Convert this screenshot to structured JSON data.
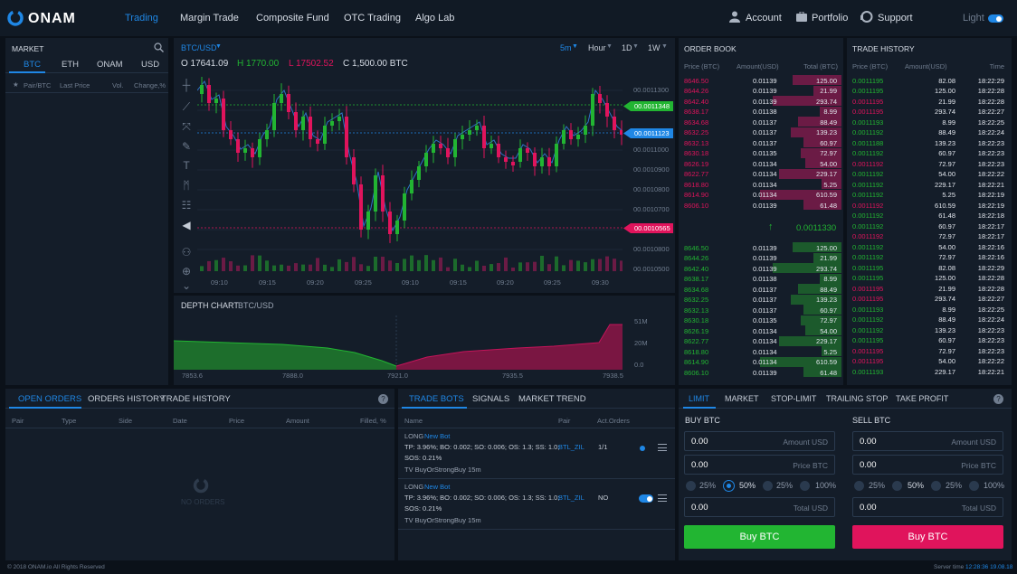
{
  "brand": {
    "name": "ONAM"
  },
  "nav": {
    "items": [
      "Trading",
      "Margin Trade",
      "Composite Fund",
      "OTC Trading",
      "Algo Lab"
    ],
    "account": "Account",
    "portfolio": "Portfolio",
    "support": "Support",
    "theme_label": "Light"
  },
  "market": {
    "title": "MARKET",
    "tabs": [
      "BTC",
      "ETH",
      "ONAM",
      "USD"
    ],
    "columns": [
      "Pair/BTC",
      "Last Price",
      "Vol.",
      "Change,%"
    ]
  },
  "chart": {
    "pair": "BTC/USD",
    "interval": "5m",
    "period_options": [
      "Hour",
      "1D",
      "1W"
    ],
    "ohlc": {
      "open": "O 17641.09",
      "high": "H 1770.00",
      "low": "L 17502.52",
      "close": "C 1,500.00 BTC"
    },
    "price_axis": [
      "00.0011300",
      "00.0011348",
      "00.0011123",
      "00.0011000",
      "00.0010900",
      "00.0010800",
      "00.0010700",
      "00.0010565",
      "00.0010800",
      "00.0010500"
    ],
    "time_axis": [
      "09:10",
      "09:15",
      "09:20",
      "09:25",
      "09:10",
      "09:15",
      "09:20",
      "09:25",
      "09:30"
    ]
  },
  "depth": {
    "title": "DEPTH CHART",
    "pair": "BTC/USD",
    "x_axis": [
      "7853.6",
      "7888.0",
      "7921.0",
      "7935.5",
      "7938.5"
    ],
    "y_axis": [
      "51M",
      "20M",
      "0.0"
    ]
  },
  "order_book": {
    "title": "ORDER BOOK",
    "columns": [
      "Price (BTC)",
      "Amount(USD)",
      "Total (BTC)"
    ],
    "asks": [
      [
        "8646.50",
        "0.01139",
        "125.00"
      ],
      [
        "8644.26",
        "0.01139",
        "21.99"
      ],
      [
        "8642.40",
        "0.01139",
        "293.74"
      ],
      [
        "8638.17",
        "0.01138",
        "8.99"
      ],
      [
        "8634.68",
        "0.01137",
        "88.49"
      ],
      [
        "8632.25",
        "0.01137",
        "139.23"
      ],
      [
        "8632.13",
        "0.01137",
        "60.97"
      ],
      [
        "8630.18",
        "0.01135",
        "72.97"
      ],
      [
        "8626.19",
        "0.01134",
        "54.00"
      ],
      [
        "8622.77",
        "0.01134",
        "229.17"
      ],
      [
        "8618.80",
        "0.01134",
        "5.25"
      ],
      [
        "8614.90",
        "0.01134",
        "610.59"
      ],
      [
        "8606.10",
        "0.01139",
        "61.48"
      ]
    ],
    "spread": "0.0011330",
    "bids": [
      [
        "8646.50",
        "0.01139",
        "125.00"
      ],
      [
        "8644.26",
        "0.01139",
        "21.99"
      ],
      [
        "8642.40",
        "0.01139",
        "293.74"
      ],
      [
        "8638.17",
        "0.01138",
        "8.99"
      ],
      [
        "8634.68",
        "0.01137",
        "88.49"
      ],
      [
        "8632.25",
        "0.01137",
        "139.23"
      ],
      [
        "8632.13",
        "0.01137",
        "60.97"
      ],
      [
        "8630.18",
        "0.01135",
        "72.97"
      ],
      [
        "8626.19",
        "0.01134",
        "54.00"
      ],
      [
        "8622.77",
        "0.01134",
        "229.17"
      ],
      [
        "8618.80",
        "0.01134",
        "5.25"
      ],
      [
        "8614.90",
        "0.01134",
        "610.59"
      ],
      [
        "8606.10",
        "0.01139",
        "61.48"
      ]
    ]
  },
  "trade_history": {
    "title": "TRADE HISTORY",
    "columns": [
      "Price (BTC)",
      "Amount(USD)",
      "Time"
    ],
    "rows": [
      [
        "0.0011195",
        "82.08",
        "18:22:29",
        "g"
      ],
      [
        "0.0011195",
        "125.00",
        "18:22:28",
        "g"
      ],
      [
        "0.0011195",
        "21.99",
        "18:22:28",
        "r"
      ],
      [
        "0.0011195",
        "293.74",
        "18:22:27",
        "r"
      ],
      [
        "0.0011193",
        "8.99",
        "18:22:25",
        "g"
      ],
      [
        "0.0011192",
        "88.49",
        "18:22:24",
        "g"
      ],
      [
        "0.0011188",
        "139.23",
        "18:22:23",
        "g"
      ],
      [
        "0.0011192",
        "60.97",
        "18:22:23",
        "g"
      ],
      [
        "0.0011192",
        "72.97",
        "18:22:23",
        "r"
      ],
      [
        "0.0011192",
        "54.00",
        "18:22:22",
        "g"
      ],
      [
        "0.0011192",
        "229.17",
        "18:22:21",
        "g"
      ],
      [
        "0.0011192",
        "5.25",
        "18:22:19",
        "g"
      ],
      [
        "0.0011192",
        "610.59",
        "18:22:19",
        "r"
      ],
      [
        "0.0011192",
        "61.48",
        "18:22:18",
        "g"
      ],
      [
        "0.0011192",
        "60.97",
        "18:22:17",
        "g"
      ],
      [
        "0.0011192",
        "72.97",
        "18:22:17",
        "r"
      ],
      [
        "0.0011192",
        "54.00",
        "18:22:16",
        "g"
      ],
      [
        "0.0011192",
        "72.97",
        "18:22:16",
        "g"
      ],
      [
        "0.0011195",
        "82.08",
        "18:22:29",
        "g"
      ],
      [
        "0.0011195",
        "125.00",
        "18:22:28",
        "g"
      ],
      [
        "0.0011195",
        "21.99",
        "18:22:28",
        "r"
      ],
      [
        "0.0011195",
        "293.74",
        "18:22:27",
        "r"
      ],
      [
        "0.0011193",
        "8.99",
        "18:22:25",
        "g"
      ],
      [
        "0.0011192",
        "88.49",
        "18:22:24",
        "g"
      ],
      [
        "0.0011192",
        "139.23",
        "18:22:23",
        "g"
      ],
      [
        "0.0011195",
        "60.97",
        "18:22:23",
        "g"
      ],
      [
        "0.0011195",
        "72.97",
        "18:22:23",
        "r"
      ],
      [
        "0.0011195",
        "54.00",
        "18:22:22",
        "r"
      ],
      [
        "0.0011193",
        "229.17",
        "18:22:21",
        "g"
      ]
    ]
  },
  "orders": {
    "tabs": [
      "OPEN ORDERS",
      "ORDERS HISTORY",
      "TRADE HISTORY"
    ],
    "columns": [
      "Pair",
      "Type",
      "Side",
      "Date",
      "Price",
      "Amount",
      "Filled, %"
    ],
    "empty": "NO ORDERS"
  },
  "bots": {
    "tabs": [
      "TRADE BOTS",
      "SIGNALS",
      "MARKET TREND"
    ],
    "columns": [
      "Name",
      "Pair",
      "Act.Orders"
    ],
    "items": [
      {
        "side": "LONG",
        "tag": "New Bot",
        "params": "TP: 3.96%; BO: 0.002; SO: 0.006; OS: 1.3; SS: 1.0;",
        "params2": "SOS: 0.21%",
        "pair": "BTL_ZIL",
        "orders": "1/1",
        "signal": "TV BuyOrStrongBuy 15m",
        "enabled": false
      },
      {
        "side": "LONG",
        "tag": "New Bot",
        "params": "TP: 3.96%; BO: 0.002; SO: 0.006; OS: 1.3; SS: 1.0;",
        "params2": "SOS: 0.21%",
        "pair": "BTL_ZIL",
        "orders": "NO",
        "signal": "TV BuyOrStrongBuy 15m",
        "enabled": true
      }
    ]
  },
  "order_form": {
    "tabs": [
      "LIMIT",
      "MARKET",
      "STOP-LIMIT",
      "TRAILING STOP",
      "TAKE PROFIT"
    ],
    "buy": {
      "title": "BUY BTC",
      "amount": "0.00",
      "amount_label": "Amount USD",
      "price": "0.00",
      "price_label": "Price BTC",
      "total": "0.00",
      "total_label": "Total USD",
      "button": "Buy BTC"
    },
    "sell": {
      "title": "SELL BTC",
      "amount": "0.00",
      "amount_label": "Amount USD",
      "price": "0.00",
      "price_label": "Price BTC",
      "total": "0.00",
      "total_label": "Total USD",
      "button": "Buy BTC"
    },
    "percents": [
      "25%",
      "50%",
      "25%",
      "100%"
    ]
  },
  "footer": {
    "copyright": "© 2018 ONAM.io All Rights Reserved",
    "server_label": "Server time",
    "server_time": "12:28:36 19.08.18"
  },
  "colors": {
    "accent": "#1f87e5",
    "green": "#22b532",
    "red": "#e0145c",
    "buy_button": "#22b532",
    "sell_button": "#e0145c"
  }
}
